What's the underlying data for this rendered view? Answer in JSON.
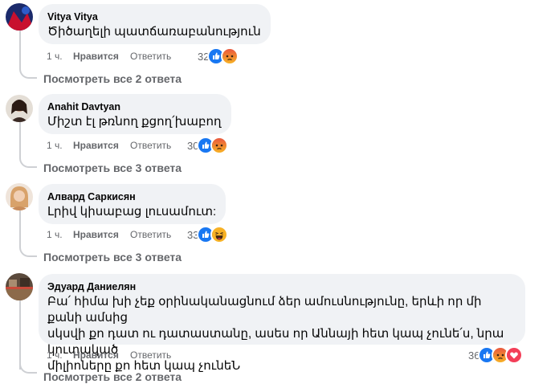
{
  "comments": [
    {
      "author": "Vitya Vitya",
      "text": [
        "Ծիծաղելի պատճառաբանություն"
      ],
      "time": "1 ч.",
      "like": "Нравится",
      "reply": "Ответить",
      "count": "32",
      "reactions": [
        "like-icon",
        "angry-icon"
      ],
      "replies": "Посмотреть все 2 ответа"
    },
    {
      "author": "Anahit Davtyan",
      "text": [
        "Միշտ էլ թռնող քցող՛խաբող"
      ],
      "time": "1 ч.",
      "like": "Нравится",
      "reply": "Ответить",
      "count": "30",
      "reactions": [
        "like-icon",
        "angry-icon"
      ],
      "replies": "Посмотреть все 3 ответа"
    },
    {
      "author": "Алвард Саркисян",
      "text": [
        "Լրիվ կիսաբաց լուսամուտ:"
      ],
      "time": "1 ч.",
      "like": "Нравится",
      "reply": "Ответить",
      "count": "33",
      "reactions": [
        "like-icon",
        "haha-icon"
      ],
      "replies": "Посмотреть все 3 ответа"
    },
    {
      "author": "Эдуард Даниелян",
      "text": [
        "Բա՛ հիմա խի չեք օրինականացնում ձեր ամուսնությունը, երևի որ մի քանի ամսից",
        "սկսվի քո դատ ու դատաստանը, ասես որ Աննայի հետ կապ չունե՛ս, նրա կուտակած",
        "միլիոները քո հետ կապ չունեՆ"
      ],
      "time": "1 ч.",
      "like": "Нравится",
      "reply": "Ответить",
      "count": "36",
      "reactions": [
        "like-icon",
        "angry-icon",
        "love-icon"
      ],
      "replies": "Посмотреть все 2 ответа"
    }
  ],
  "colors": {
    "like": "#1877f2",
    "angry": "#f0503c",
    "haha": "#f7b125",
    "love": "#f33e58",
    "bubble": "#f0f2f5",
    "meta": "#65676b"
  }
}
